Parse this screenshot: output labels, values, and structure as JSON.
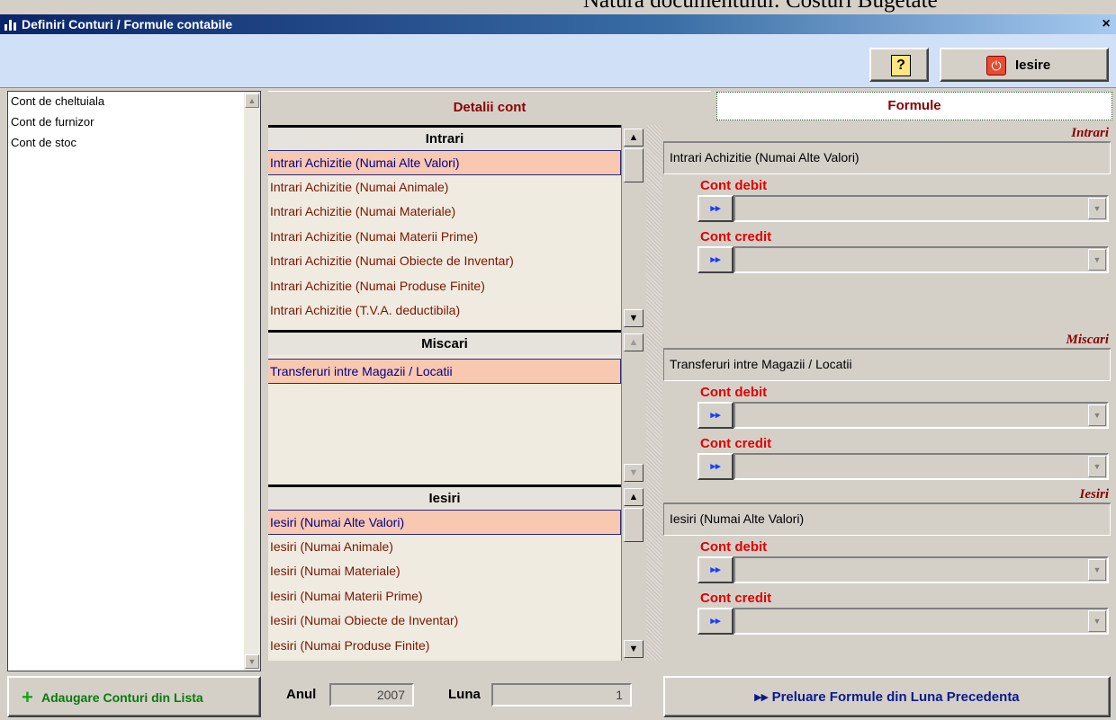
{
  "background_text": "Natura documentului: Costuri Bugetate",
  "window": {
    "title": "Definiri Conturi / Formule contabile",
    "close_glyph": "×"
  },
  "toolbar": {
    "help_glyph": "?",
    "exit_label": "Iesire",
    "exit_glyph": "⏻"
  },
  "left_list": {
    "items": [
      "Cont de cheltuiala",
      "Cont de furnizor",
      "Cont de stoc"
    ]
  },
  "add_button": {
    "label": "Adaugare Conturi din Lista",
    "glyph": "+"
  },
  "tabs": {
    "details": "Detalii cont",
    "formulas": "Formule"
  },
  "sections": {
    "intrari": {
      "title": "Intrari",
      "rows": [
        "Intrari Achizitie (Numai Alte Valori)",
        "Intrari Achizitie (Numai Animale)",
        "Intrari Achizitie (Numai Materiale)",
        "Intrari Achizitie (Numai Materii Prime)",
        "Intrari Achizitie (Numai Obiecte de Inventar)",
        "Intrari Achizitie (Numai Produse Finite)",
        "Intrari Achizitie (T.V.A. deductibila)"
      ]
    },
    "miscari": {
      "title": "Miscari",
      "rows": [
        "Transferuri intre Magazii / Locatii"
      ]
    },
    "iesiri": {
      "title": "Iesiri",
      "rows": [
        "Iesiri (Numai Alte Valori)",
        "Iesiri (Numai Animale)",
        "Iesiri (Numai Materiale)",
        "Iesiri (Numai Materii Prime)",
        "Iesiri (Numai Obiecte de Inventar)",
        "Iesiri (Numai Produse Finite)"
      ]
    }
  },
  "formulas": {
    "intrari": {
      "label": "Intrari",
      "selected": "Intrari Achizitie (Numai Alte Valori)",
      "debit_label": "Cont debit",
      "credit_label": "Cont credit",
      "debit_value": "",
      "credit_value": ""
    },
    "miscari": {
      "label": "Miscari",
      "selected": "Transferuri intre Magazii / Locatii",
      "debit_label": "Cont debit",
      "credit_label": "Cont credit",
      "debit_value": "",
      "credit_value": ""
    },
    "iesiri": {
      "label": "Iesiri",
      "selected": "Iesiri (Numai Alte Valori)",
      "debit_label": "Cont debit",
      "credit_label": "Cont credit",
      "debit_value": "",
      "credit_value": ""
    }
  },
  "glyphs": {
    "arrow_btn": "▸▸",
    "dropdown": "▼",
    "scroll_up": "▲",
    "scroll_down": "▼"
  },
  "footer": {
    "anul_label": "Anul",
    "anul_value": "2007",
    "luna_label": "Luna",
    "luna_value": "1",
    "preluare_label": "Preluare Formule din Luna Precedenta"
  },
  "colors": {
    "title_bar": "#0a246a",
    "toolbar_bg": "#cfe0f7",
    "row_text": "#7a1500",
    "selected_row": "#f9c8b0",
    "label_red": "#e00000",
    "tab_text": "#8b0000"
  }
}
